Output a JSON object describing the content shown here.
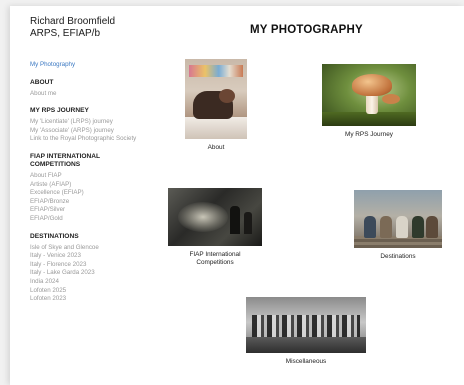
{
  "header": {
    "site_name_line1": "Richard Broomfield",
    "site_name_line2": "ARPS, EFIAP/b",
    "page_title": "MY PHOTOGRAPHY"
  },
  "sidebar": {
    "home_link": "My Photography",
    "sections": [
      {
        "heading": "ABOUT",
        "links": [
          "About me"
        ]
      },
      {
        "heading": "MY RPS JOURNEY",
        "links": [
          "My 'Licentiate' (LRPS) journey",
          "My 'Associate' (ARPS) journey",
          "Link to the Royal Photographic Society"
        ]
      },
      {
        "heading": "FIAP INTERNATIONAL COMPETITIONS",
        "links": [
          "About FIAP",
          "Artiste (AFIAP)",
          "Excellence (EFIAP)",
          "EFIAP/Bronze",
          "EFIAP/Silver",
          "EFIAP/Gold"
        ]
      },
      {
        "heading": "DESTINATIONS",
        "links": [
          "Isle of Skye and Glencoe",
          "Italy - Venice 2023",
          "Italy - Florence 2023",
          "Italy - Lake Garda 2023",
          "India 2024",
          "Lofoten 2025",
          "Lofoten 2023"
        ]
      }
    ]
  },
  "gallery": [
    {
      "caption": "About",
      "icon": "photo-child-sleeping"
    },
    {
      "caption": "My RPS Journey",
      "icon": "photo-mushroom"
    },
    {
      "caption": "FIAP International Competitions",
      "icon": "photo-smoky-figures"
    },
    {
      "caption": "Destinations",
      "icon": "photo-group-on-steps"
    },
    {
      "caption": "Miscellaneous",
      "icon": "photo-group-black-white"
    }
  ]
}
